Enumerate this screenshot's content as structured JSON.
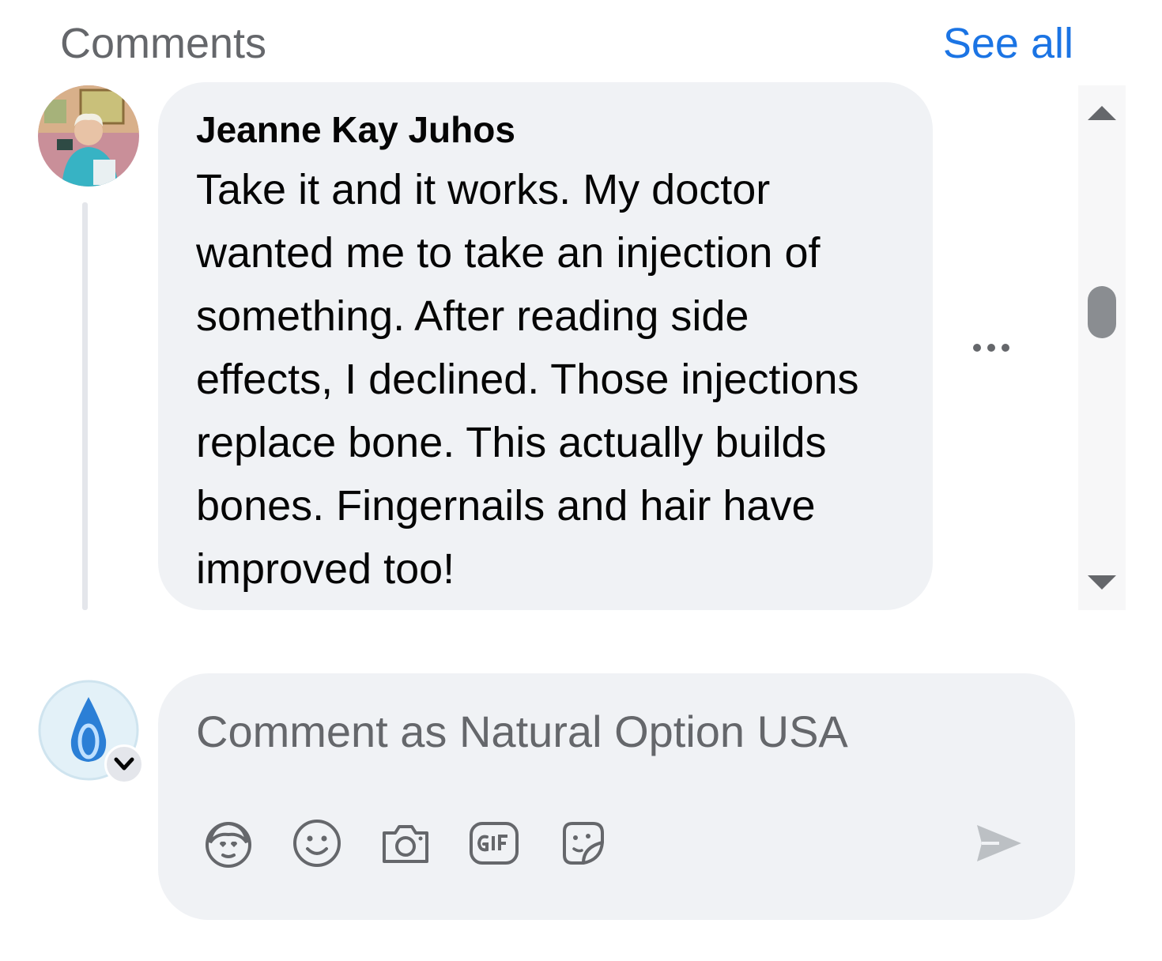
{
  "header": {
    "title": "Comments",
    "see_all_label": "See all"
  },
  "comment": {
    "author": "Jeanne Kay Juhos",
    "text": "Take it and it works. My doctor wanted me to take an injection of something. After reading side effects, I declined. Those injections replace bone. This actually builds bones. Fingernails and hair have improved too!"
  },
  "composer": {
    "placeholder": "Comment as Natural Option USA",
    "value": "",
    "tools": [
      "avatar-sticker-icon",
      "emoji-icon",
      "camera-icon",
      "gif-icon",
      "sticker-icon"
    ]
  },
  "colors": {
    "accent": "#1b74e4",
    "bubble": "#f0f2f5",
    "muted_text": "#65676b",
    "text": "#050505"
  }
}
